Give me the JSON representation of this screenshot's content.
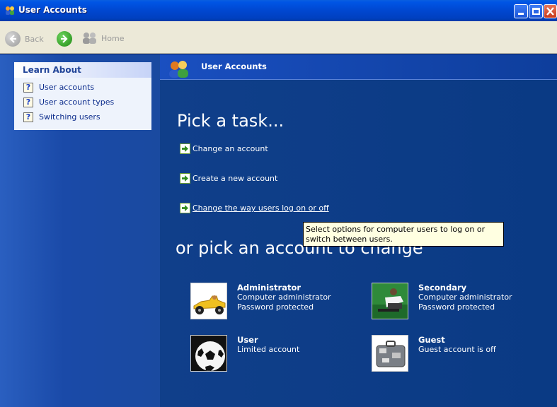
{
  "window": {
    "title": "User Accounts"
  },
  "toolbar": {
    "back_label": "Back",
    "home_label": "Home"
  },
  "left": {
    "heading": "Learn About",
    "items": [
      {
        "label": "User accounts",
        "icon": "help-icon"
      },
      {
        "label": "User account types",
        "icon": "help-icon"
      },
      {
        "label": "Switching users",
        "icon": "help-icon"
      }
    ]
  },
  "right": {
    "header_title": "User Accounts",
    "pick_title": "Pick a task...",
    "tasks": [
      {
        "label": "Change an account"
      },
      {
        "label": "Create a new account"
      },
      {
        "label": "Change the way users log on or off"
      }
    ],
    "or_title": "or pick an account to change",
    "tooltip": "Select options for computer users to log on or switch between users.",
    "accounts": [
      {
        "name": "Administrator",
        "line1": "Computer administrator",
        "line2": "Password protected",
        "picture": "race-car-picture"
      },
      {
        "name": "Secondary",
        "line1": "Computer administrator",
        "line2": "Password protected",
        "picture": "skateboarder-picture"
      },
      {
        "name": "User",
        "line1": "Limited account",
        "line2": "",
        "picture": "soccer-ball-picture"
      },
      {
        "name": "Guest",
        "line1": "Guest account is off",
        "line2": "",
        "picture": "suitcase-picture"
      }
    ]
  },
  "colors": {
    "title_bar": "#0047d0",
    "left_pane": "#1a4aa8",
    "right_pane": "#0a3a84",
    "tooltip_bg": "#ffffe1",
    "task_arrow": "#2e8b1a"
  }
}
